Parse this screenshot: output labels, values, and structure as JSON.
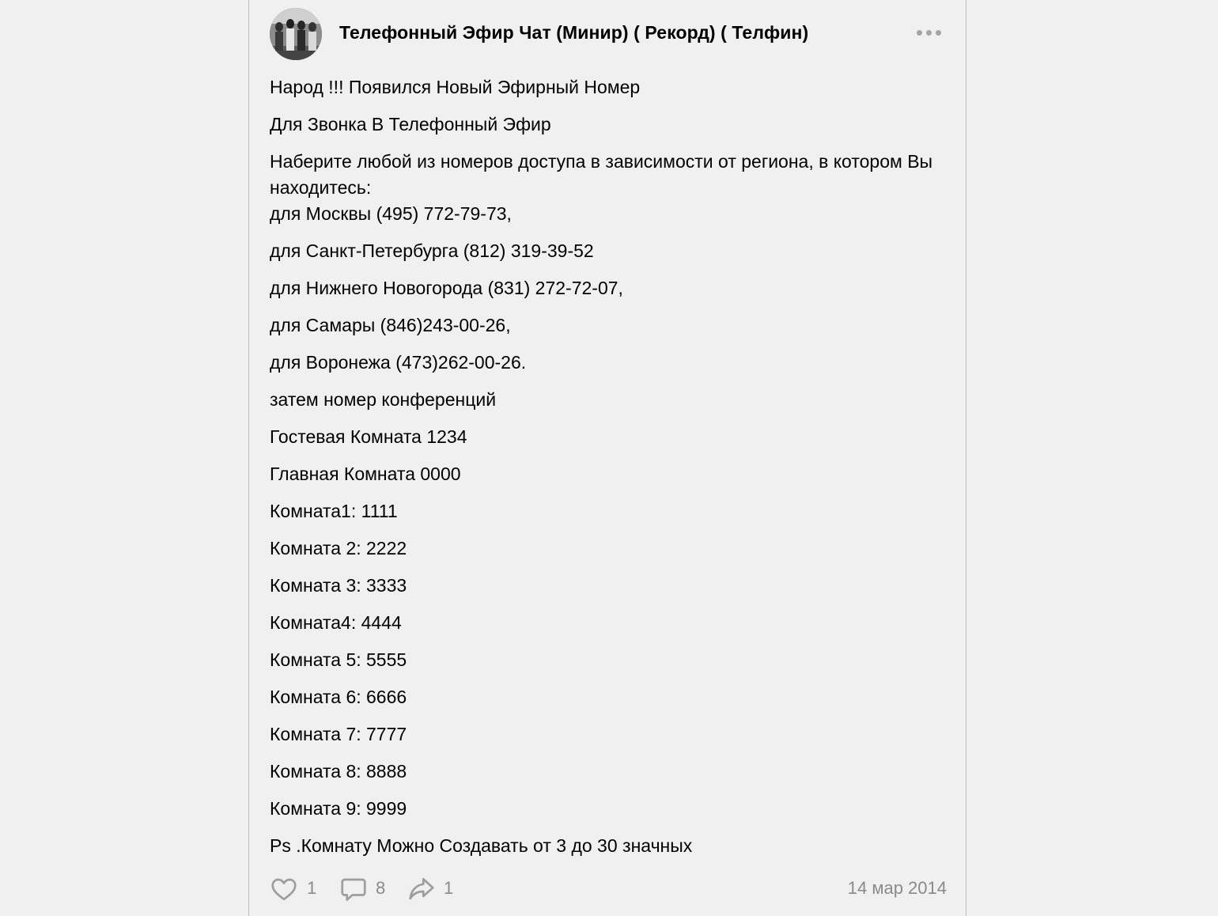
{
  "post": {
    "author": "Телефонный Эфир Чат (Минир) ( Рекорд) ( Телфин)",
    "paragraphs": {
      "p0": "Народ !!! Появился Новый Эфирный Номер",
      "p1": "Для Звонка В Телефонный Эфир",
      "p2": "Наберите любой из номеров доступа в зависимости от региона, в котором Вы находитесь:",
      "p3": "для Москвы (495) 772-79-73,",
      "p4": "для Санкт-Петербурга (812) 319-39-52",
      "p5": "для Нижнего Новогорода (831) 272-72-07,",
      "p6": "для Самары (846)243-00-26,",
      "p7": "для Воронежа (473)262-00-26.",
      "p8": "затем номер конференций",
      "p9": "Гостевая Комната 1234",
      "p10": "Главная Комната 0000",
      "p11": "Комната1: 1111",
      "p12": "Комната 2: 2222",
      "p13": "Комната 3: 3333",
      "p14": "Комната4: 4444",
      "p15": "Комната 5: 5555",
      "p16": "Комната 6: 6666",
      "p17": "Комната 7: 7777",
      "p18": "Комната 8: 8888",
      "p19": "Комната 9: 9999",
      "p20": "Ps .Комнату Можно Создавать от 3 до 30 значных"
    },
    "likes": "1",
    "comments": "8",
    "shares": "1",
    "date": "14 мар 2014"
  },
  "icons": {
    "menu": "more-horizontal-icon",
    "like": "heart-icon",
    "comment": "comment-bubble-icon",
    "share": "share-arrow-icon"
  },
  "colors": {
    "background": "#f0f0f0",
    "text": "#000000",
    "muted": "#8a8a8a",
    "icon": "#9e9e9e",
    "border": "#bdbdbd"
  }
}
